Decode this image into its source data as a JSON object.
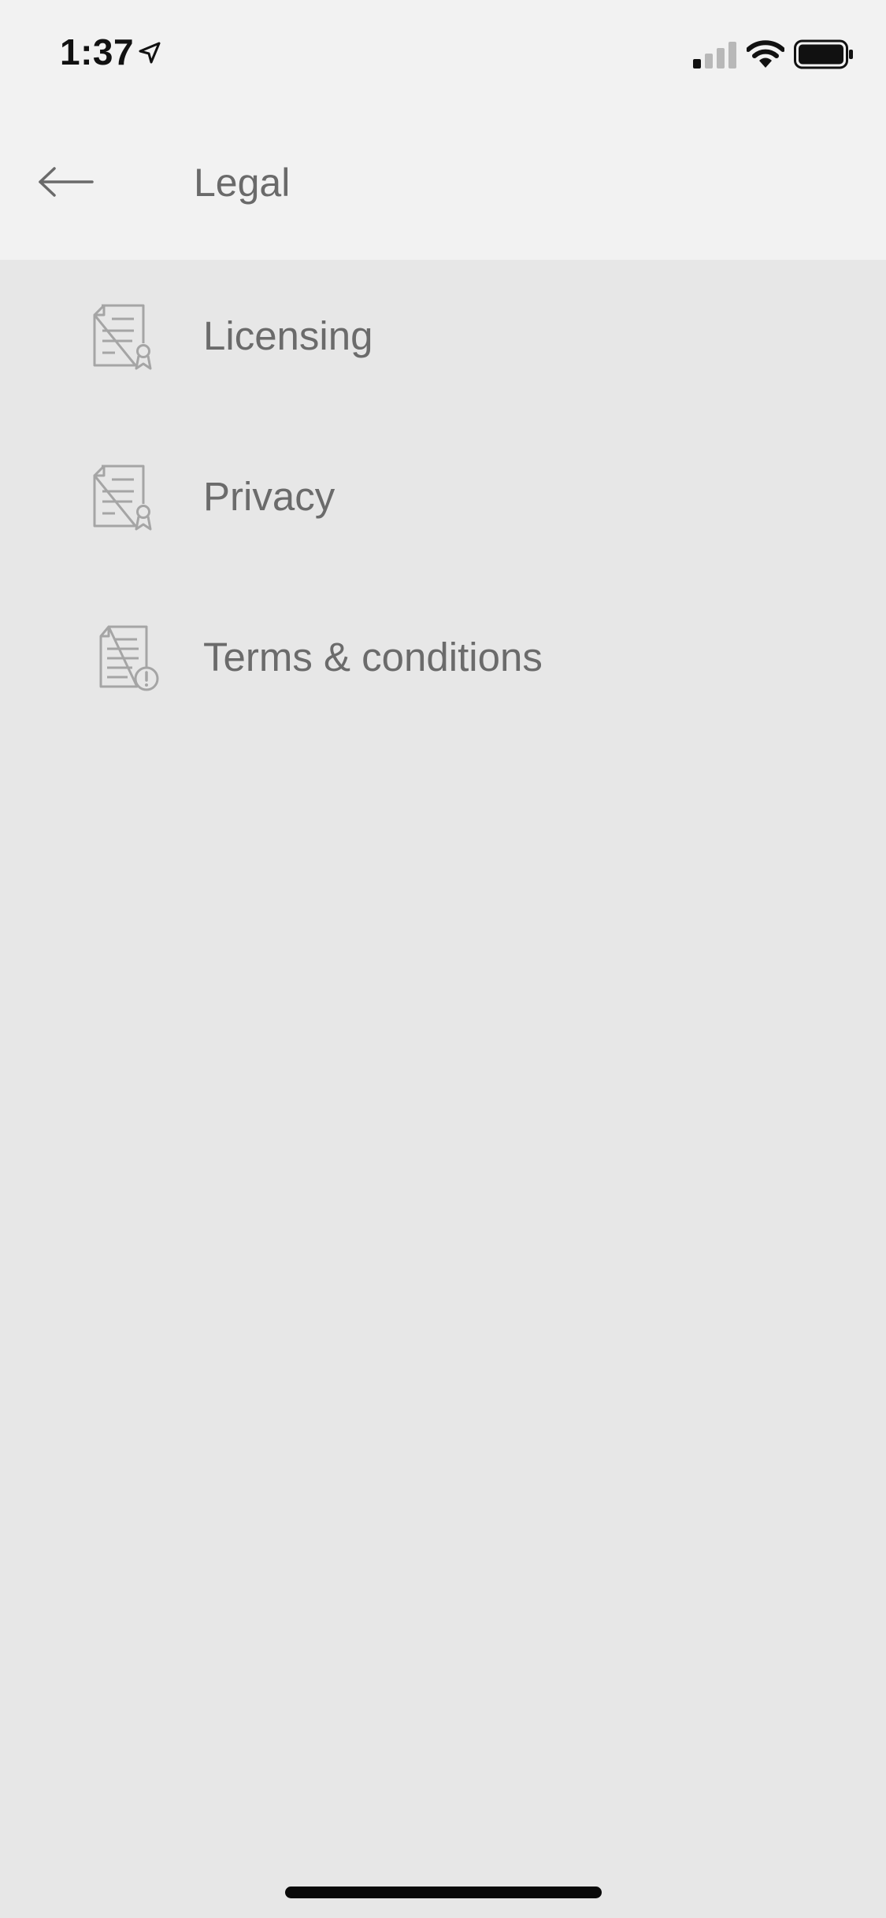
{
  "status_bar": {
    "time": "1:37",
    "location_icon": "location-arrow-icon",
    "signal_icon": "cellular-signal-icon",
    "wifi_icon": "wifi-icon",
    "battery_icon": "battery-icon"
  },
  "header": {
    "back_icon": "arrow-left-icon",
    "title": "Legal"
  },
  "items": [
    {
      "label": "Licensing",
      "icon": "certificate-document-icon"
    },
    {
      "label": "Privacy",
      "icon": "certificate-document-icon"
    },
    {
      "label": "Terms & conditions",
      "icon": "document-alert-icon"
    }
  ],
  "colors": {
    "header_bg": "#f2f2f2",
    "page_bg": "#e7e7e7",
    "text": "#6b6b6b",
    "icon": "#a5a5a5"
  }
}
